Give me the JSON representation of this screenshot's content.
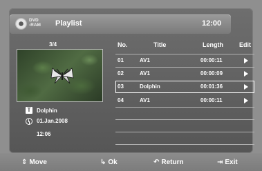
{
  "header": {
    "disc_line1": "DVD",
    "disc_line2": "-RAM",
    "title": "Playlist",
    "clock": "12:00"
  },
  "preview": {
    "counter": "3/4",
    "thumbnail": "dolphin-butterfly-image",
    "info_title": "Dolphin",
    "info_date": "01.Jan.2008",
    "info_time": "12:06",
    "title_icon_letter": "T"
  },
  "table": {
    "columns": [
      "No.",
      "Title",
      "Length",
      "Edit"
    ],
    "rows": [
      {
        "no": "01",
        "title": "AV1",
        "length": "00:00:11",
        "selected": false
      },
      {
        "no": "02",
        "title": "AV1",
        "length": "00:00:09",
        "selected": false
      },
      {
        "no": "03",
        "title": "Dolphin",
        "length": "00:01:36",
        "selected": true
      },
      {
        "no": "04",
        "title": "AV1",
        "length": "00:00:11",
        "selected": false
      }
    ]
  },
  "footer": {
    "move": "Move",
    "ok": "Ok",
    "return": "Return",
    "exit": "Exit",
    "move_glyph": "⇕",
    "ok_glyph": "↳",
    "return_glyph": "↶",
    "exit_glyph": "⇥"
  },
  "colors": {
    "background": "#8f8f8f",
    "panel": "#5e5e5e",
    "text": "#ffffff",
    "selection_border": "#ffffff"
  }
}
